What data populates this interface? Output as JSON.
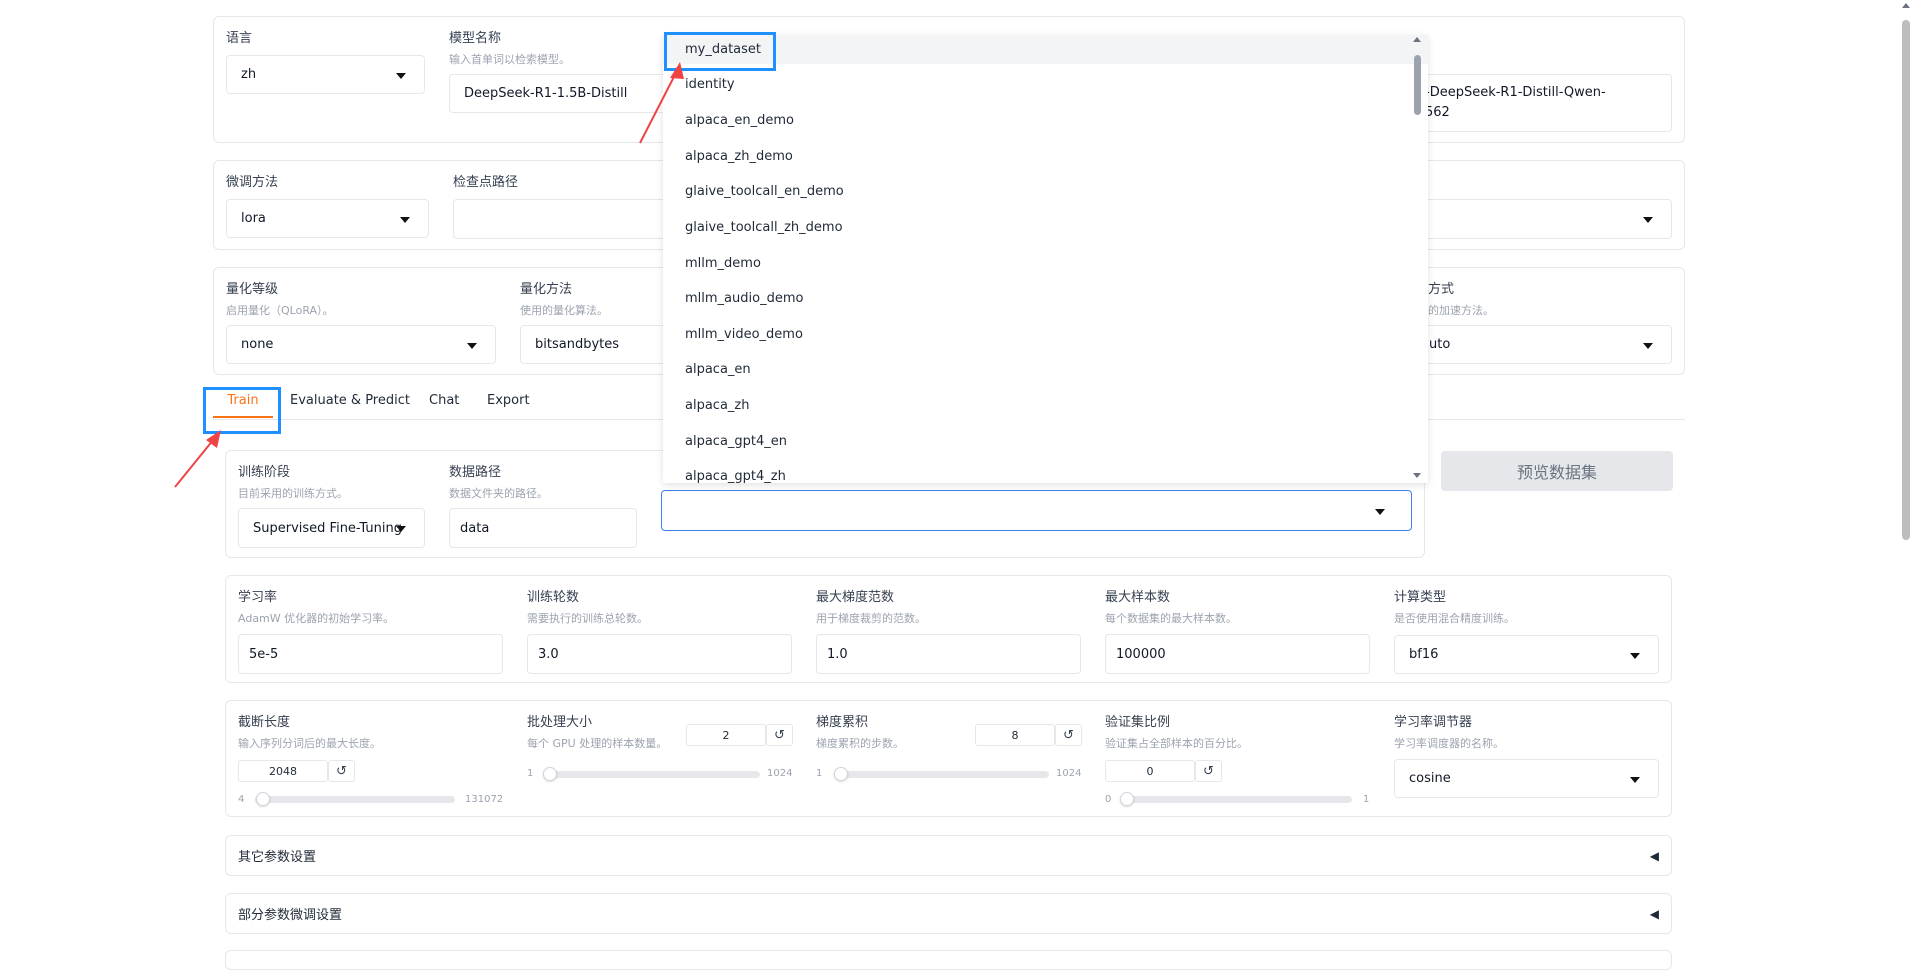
{
  "top": {
    "language": {
      "label": "语言",
      "value": "zh"
    },
    "model_name": {
      "label": "模型名称",
      "desc": "输入首单词以检索模型。",
      "value": "DeepSeek-R1-1.5B-Distill"
    },
    "model_path_partial": {
      "line1": "-DeepSeek-R1-Distill-Qwen-",
      "line2": "562"
    }
  },
  "row2": {
    "finetune": {
      "label": "微调方法",
      "value": "lora"
    },
    "checkpoint": {
      "label": "检查点路径",
      "value": ""
    }
  },
  "row3": {
    "quant_level": {
      "label": "量化等级",
      "desc": "启用量化（QLoRA）。",
      "value": "none"
    },
    "quant_method": {
      "label": "量化方法",
      "desc": "使用的量化算法。",
      "value": "bitsandbytes"
    },
    "accel": {
      "label_partial": "方式",
      "desc_partial": "的加速方法。",
      "value_partial": "uto"
    }
  },
  "tabs": [
    "Train",
    "Evaluate & Predict",
    "Chat",
    "Export"
  ],
  "train": {
    "stage": {
      "label": "训练阶段",
      "desc": "目前采用的训练方式。",
      "value": "Supervised Fine-Tuning"
    },
    "data_dir": {
      "label": "数据路径",
      "desc": "数据文件夹的路径。",
      "value": "data"
    },
    "dataset_value": "",
    "preview_button": "预览数据集"
  },
  "dropdown_options": [
    "my_dataset",
    "identity",
    "alpaca_en_demo",
    "alpaca_zh_demo",
    "glaive_toolcall_en_demo",
    "glaive_toolcall_zh_demo",
    "mllm_demo",
    "mllm_audio_demo",
    "mllm_video_demo",
    "alpaca_en",
    "alpaca_zh",
    "alpaca_gpt4_en",
    "alpaca_gpt4_zh"
  ],
  "params": {
    "lr": {
      "label": "学习率",
      "desc": "AdamW 优化器的初始学习率。",
      "value": "5e-5"
    },
    "epochs": {
      "label": "训练轮数",
      "desc": "需要执行的训练总轮数。",
      "value": "3.0"
    },
    "grad_norm": {
      "label": "最大梯度范数",
      "desc": "用于梯度裁剪的范数。",
      "value": "1.0"
    },
    "max_samples": {
      "label": "最大样本数",
      "desc": "每个数据集的最大样本数。",
      "value": "100000"
    },
    "compute_type": {
      "label": "计算类型",
      "desc": "是否使用混合精度训练。",
      "value": "bf16"
    }
  },
  "sliders": {
    "cutoff": {
      "label": "截断长度",
      "desc": "输入序列分词后的最大长度。",
      "value": "2048",
      "min": "4",
      "max": "131072",
      "fraction": 0.015
    },
    "batch": {
      "label": "批处理大小",
      "desc": "每个 GPU 处理的样本数量。",
      "value": "2",
      "min": "1",
      "max": "1024",
      "fraction": 0.001
    },
    "grad_accum": {
      "label": "梯度累积",
      "desc": "梯度累积的步数。",
      "value": "8",
      "min": "1",
      "max": "1024",
      "fraction": 0.007
    },
    "val_size": {
      "label": "验证集比例",
      "desc": "验证集占全部样本的百分比。",
      "value": "0",
      "min": "0",
      "max": "1",
      "fraction": 0.0
    },
    "scheduler": {
      "label": "学习率调节器",
      "desc": "学习率调度器的名称。",
      "value": "cosine"
    }
  },
  "reset_glyph": "↺",
  "accordions": {
    "other": "其它参数设置",
    "partial": "部分参数微调设置",
    "arrow": "◀"
  },
  "colors": {
    "accent": "#f97316",
    "highlight": "#1e90ff",
    "annotation": "#ef4444"
  }
}
